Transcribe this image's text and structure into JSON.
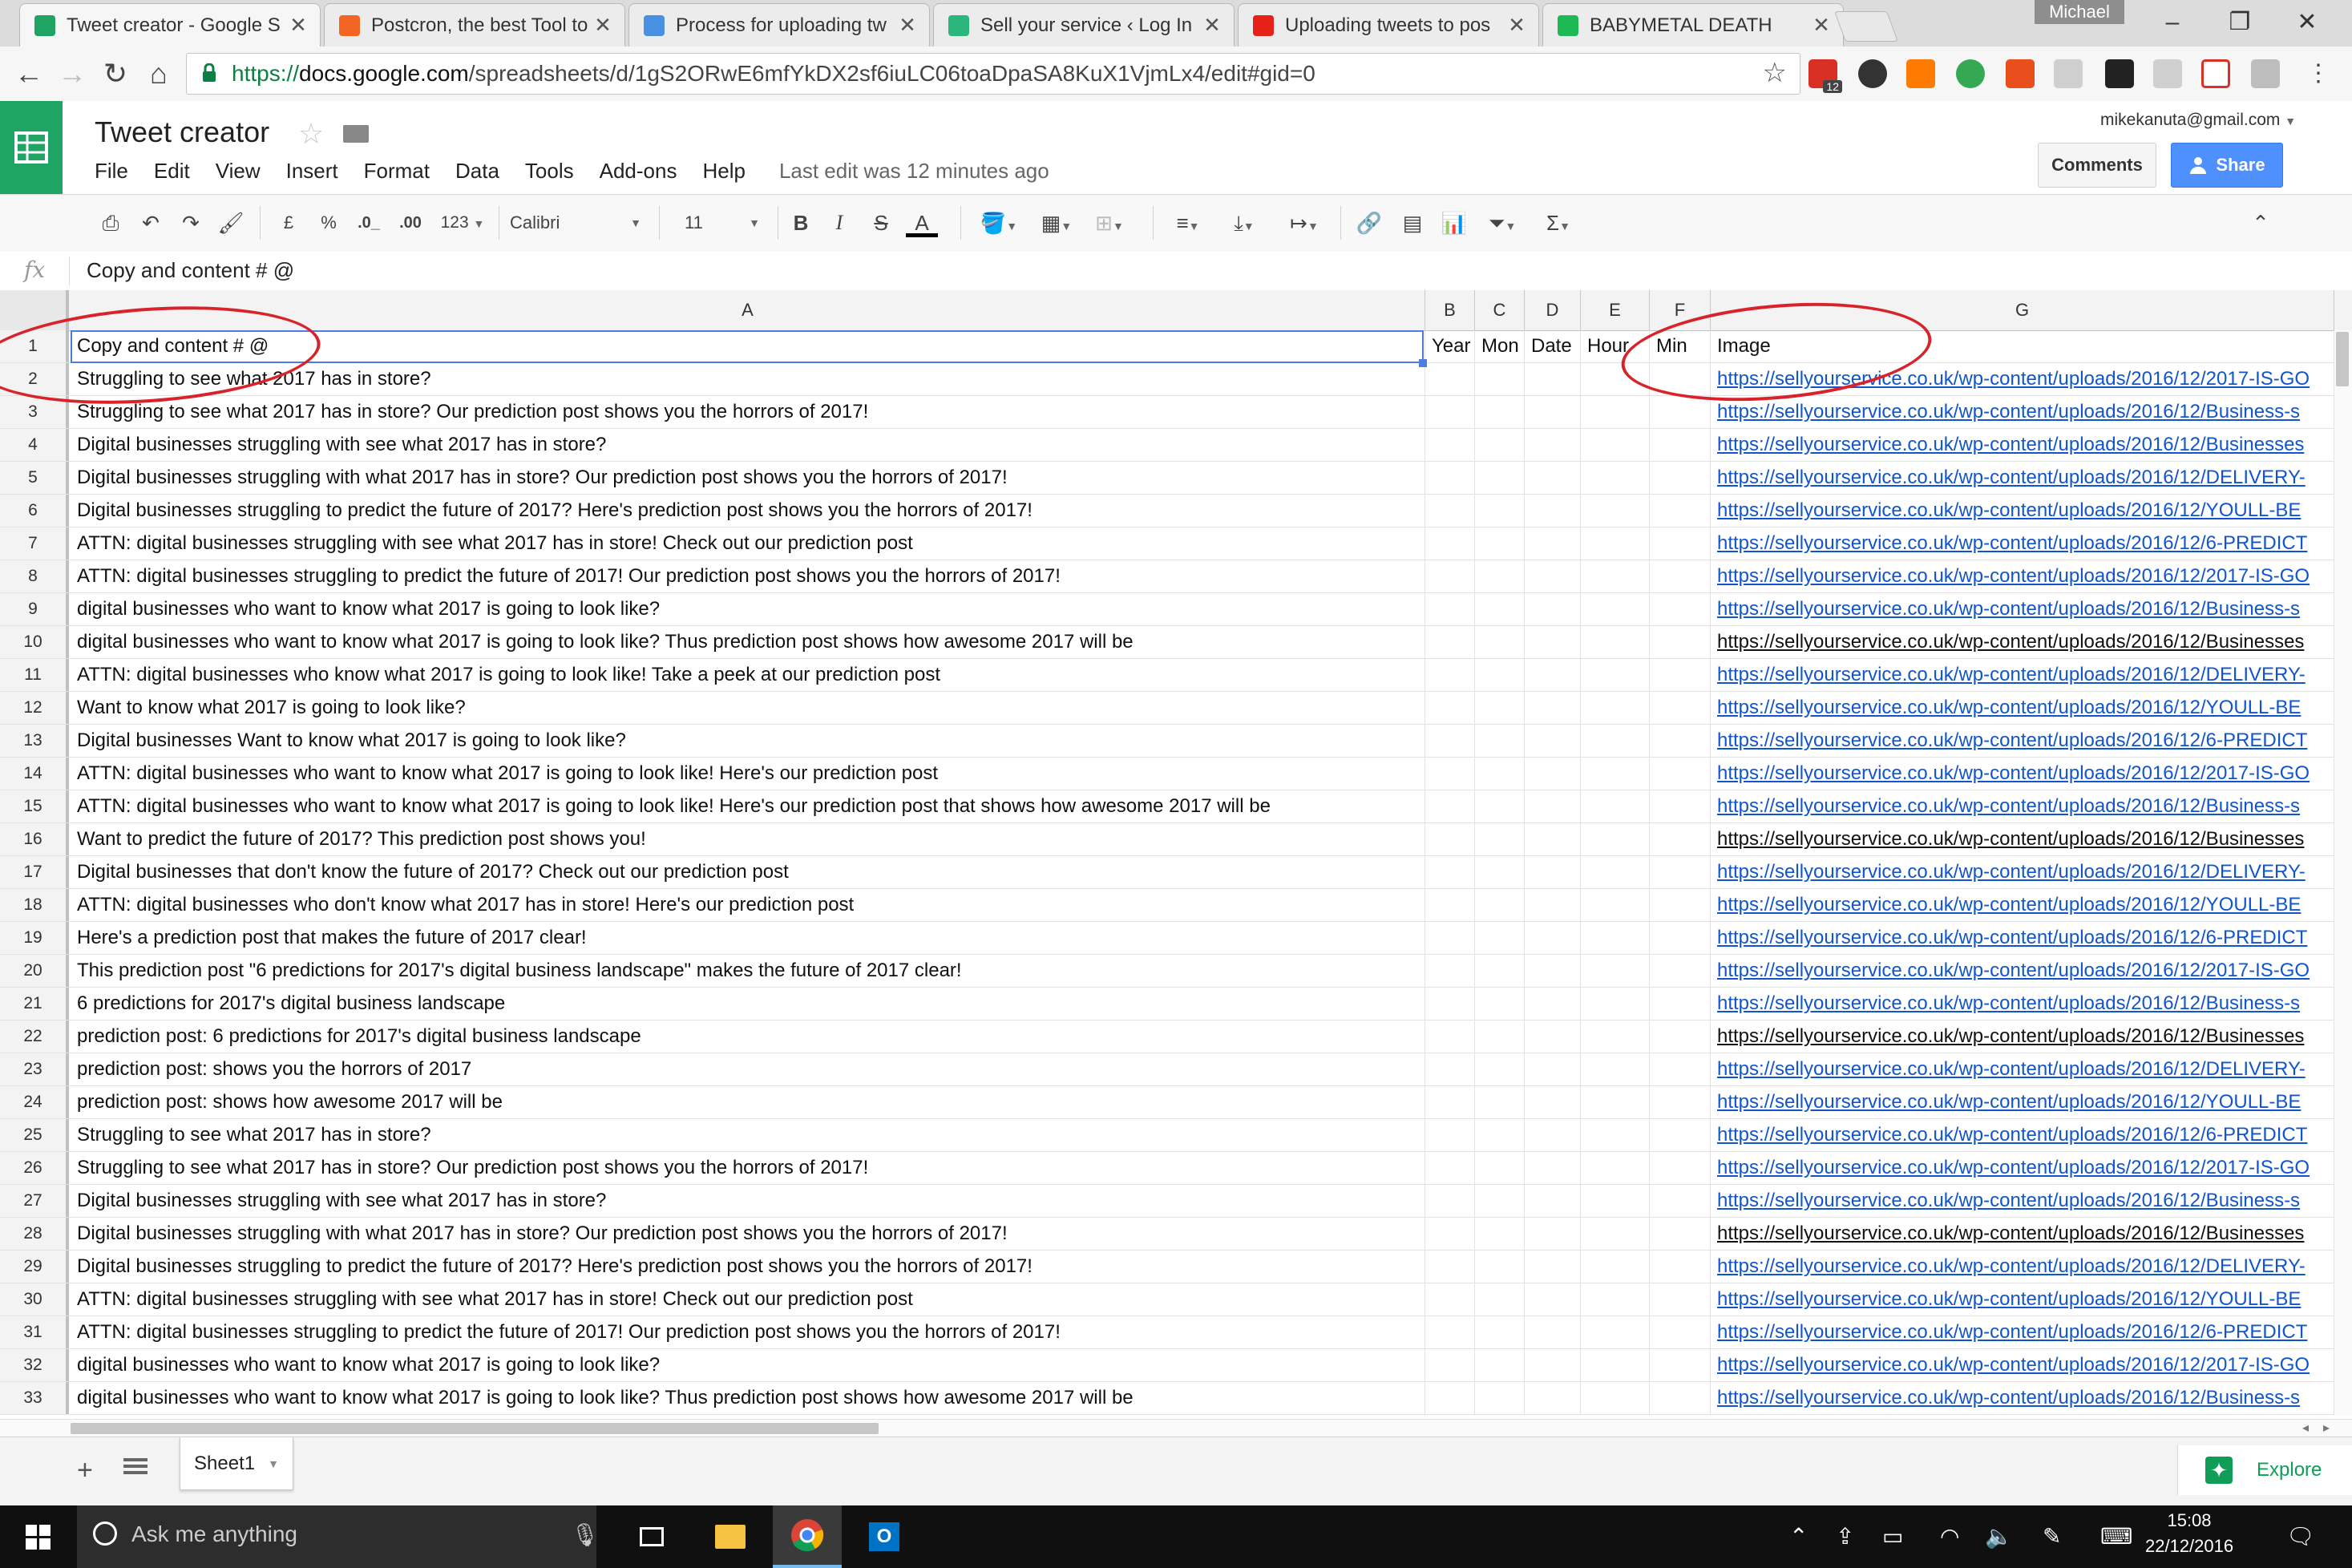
{
  "browser": {
    "tabs": [
      {
        "label": "Tweet creator - Google S",
        "icon": "google-sheets-icon",
        "color": "#1fa463",
        "active": true
      },
      {
        "label": "Postcron, the best Tool to",
        "icon": "postcron-icon",
        "color": "#f26522",
        "active": false
      },
      {
        "label": "Process for uploading tw",
        "icon": "process-icon",
        "color": "#4a90e2",
        "active": false
      },
      {
        "label": "Sell your service ‹ Log In",
        "icon": "page-icon",
        "color": "#2cb67d",
        "active": false
      },
      {
        "label": "Uploading tweets to pos",
        "icon": "youtube-icon",
        "color": "#e62117",
        "active": false
      },
      {
        "label": "BABYMETAL DEATH",
        "icon": "spotify-icon",
        "color": "#1db954",
        "active": false
      }
    ],
    "profile_name": "Michael",
    "url": {
      "scheme": "https://",
      "host": "docs.google.com",
      "path": "/spreadsheets/d/1gS2ORwE6mfYkDX2sf6iuLC06toaDpaSA8KuX1VjmLx4/edit#gid=0"
    },
    "extension_badge": "12"
  },
  "sheets": {
    "title": "Tweet creator",
    "menus": [
      "File",
      "Edit",
      "View",
      "Insert",
      "Format",
      "Data",
      "Tools",
      "Add-ons",
      "Help"
    ],
    "last_edit": "Last edit was 12 minutes ago",
    "account": "mikekanuta@gmail.com",
    "comments_label": "Comments",
    "share_label": "Share",
    "toolbar": {
      "currency": "£",
      "percent": "%",
      "dec_less": ".0_",
      "dec_more": ".00",
      "more_formats": "123",
      "font": "Calibri",
      "font_size": "11",
      "bold": "B",
      "italic": "I",
      "strike": "S",
      "text_color": "A"
    },
    "formula_icon": "fx",
    "formula_value": "Copy and content # @",
    "columns": [
      "A",
      "B",
      "C",
      "D",
      "E",
      "F",
      "G"
    ],
    "sheet_tab": "Sheet1",
    "explore_label": "Explore",
    "header_row": {
      "num": "1",
      "a": "Copy and content # @",
      "b": "Year",
      "c": "Mon",
      "d": "Date",
      "e": "Hour",
      "f": "Min",
      "g": "Image"
    },
    "rows": [
      {
        "num": "2",
        "a": "Struggling to see what 2017 has in store?",
        "g": "https://sellyourservice.co.uk/wp-content/uploads/2016/12/2017-IS-GO",
        "link": true
      },
      {
        "num": "3",
        "a": "Struggling to see what 2017 has in store? Our prediction post shows you the horrors of 2017!",
        "g": "https://sellyourservice.co.uk/wp-content/uploads/2016/12/Business-s",
        "link": true
      },
      {
        "num": "4",
        "a": "Digital businesses struggling with see what 2017 has in store?",
        "g": "https://sellyourservice.co.uk/wp-content/uploads/2016/12/Businesses",
        "link": true
      },
      {
        "num": "5",
        "a": "Digital businesses struggling with what 2017 has in store? Our prediction post shows you the horrors of 2017!",
        "g": "https://sellyourservice.co.uk/wp-content/uploads/2016/12/DELIVERY-",
        "link": true
      },
      {
        "num": "6",
        "a": "Digital businesses struggling to predict the future of 2017? Here's prediction post shows you the horrors of 2017!",
        "g": "https://sellyourservice.co.uk/wp-content/uploads/2016/12/YOULL-BE",
        "link": true
      },
      {
        "num": "7",
        "a": "ATTN: digital businesses struggling with see what 2017 has in store! Check out our prediction post",
        "g": "https://sellyourservice.co.uk/wp-content/uploads/2016/12/6-PREDICT",
        "link": true
      },
      {
        "num": "8",
        "a": "ATTN: digital businesses struggling to predict the future of 2017! Our prediction post shows you the horrors of 2017!",
        "g": "https://sellyourservice.co.uk/wp-content/uploads/2016/12/2017-IS-GO",
        "link": true
      },
      {
        "num": "9",
        "a": "digital businesses who want to know what 2017 is going to look like?",
        "g": "https://sellyourservice.co.uk/wp-content/uploads/2016/12/Business-s",
        "link": true
      },
      {
        "num": "10",
        "a": "digital businesses who want to know what 2017 is going to look like? Thus prediction post shows how awesome 2017 will be",
        "g": "https://sellyourservice.co.uk/wp-content/uploads/2016/12/Businesses",
        "link": false
      },
      {
        "num": "11",
        "a": "ATTN: digital businesses who know what 2017 is going to look like! Take a peek at our prediction post",
        "g": "https://sellyourservice.co.uk/wp-content/uploads/2016/12/DELIVERY-",
        "link": true
      },
      {
        "num": "12",
        "a": "Want to know what 2017 is going to look like?",
        "g": "https://sellyourservice.co.uk/wp-content/uploads/2016/12/YOULL-BE",
        "link": true
      },
      {
        "num": "13",
        "a": "Digital businesses Want to know what 2017 is going to look like?",
        "g": "https://sellyourservice.co.uk/wp-content/uploads/2016/12/6-PREDICT",
        "link": true
      },
      {
        "num": "14",
        "a": "ATTN: digital businesses who want to know what 2017 is going to look like! Here's our prediction post",
        "g": "https://sellyourservice.co.uk/wp-content/uploads/2016/12/2017-IS-GO",
        "link": true
      },
      {
        "num": "15",
        "a": "ATTN: digital businesses who want to know what 2017 is going to look like! Here's our prediction post that shows how awesome 2017 will be",
        "g": "https://sellyourservice.co.uk/wp-content/uploads/2016/12/Business-s",
        "link": true
      },
      {
        "num": "16",
        "a": "Want to predict the future of 2017? This prediction post shows you!",
        "g": "https://sellyourservice.co.uk/wp-content/uploads/2016/12/Businesses",
        "link": false
      },
      {
        "num": "17",
        "a": "Digital businesses that don't know the future of 2017? Check out our prediction post",
        "g": "https://sellyourservice.co.uk/wp-content/uploads/2016/12/DELIVERY-",
        "link": true
      },
      {
        "num": "18",
        "a": "ATTN: digital businesses who don't know what 2017 has in store! Here's our prediction post",
        "g": "https://sellyourservice.co.uk/wp-content/uploads/2016/12/YOULL-BE",
        "link": true
      },
      {
        "num": "19",
        "a": "Here's a prediction post that makes the future of 2017 clear!",
        "g": "https://sellyourservice.co.uk/wp-content/uploads/2016/12/6-PREDICT",
        "link": true
      },
      {
        "num": "20",
        "a": "This prediction post \"6 predictions for 2017's digital business landscape\" makes the future of 2017 clear!",
        "g": "https://sellyourservice.co.uk/wp-content/uploads/2016/12/2017-IS-GO",
        "link": true
      },
      {
        "num": "21",
        "a": "6 predictions for 2017's digital business landscape",
        "g": "https://sellyourservice.co.uk/wp-content/uploads/2016/12/Business-s",
        "link": true
      },
      {
        "num": "22",
        "a": "prediction post: 6 predictions for 2017's digital business landscape",
        "g": "https://sellyourservice.co.uk/wp-content/uploads/2016/12/Businesses",
        "link": false
      },
      {
        "num": "23",
        "a": "prediction post: shows you the horrors of 2017",
        "g": "https://sellyourservice.co.uk/wp-content/uploads/2016/12/DELIVERY-",
        "link": true
      },
      {
        "num": "24",
        "a": "prediction post: shows how awesome 2017 will be",
        "g": "https://sellyourservice.co.uk/wp-content/uploads/2016/12/YOULL-BE",
        "link": true
      },
      {
        "num": "25",
        "a": "Struggling to see what 2017 has in store?",
        "g": "https://sellyourservice.co.uk/wp-content/uploads/2016/12/6-PREDICT",
        "link": true
      },
      {
        "num": "26",
        "a": "Struggling to see what 2017 has in store? Our prediction post shows you the horrors of 2017!",
        "g": "https://sellyourservice.co.uk/wp-content/uploads/2016/12/2017-IS-GO",
        "link": true
      },
      {
        "num": "27",
        "a": "Digital businesses struggling with see what 2017 has in store?",
        "g": "https://sellyourservice.co.uk/wp-content/uploads/2016/12/Business-s",
        "link": true
      },
      {
        "num": "28",
        "a": "Digital businesses struggling with what 2017 has in store? Our prediction post shows you the horrors of 2017!",
        "g": "https://sellyourservice.co.uk/wp-content/uploads/2016/12/Businesses",
        "link": false
      },
      {
        "num": "29",
        "a": "Digital businesses struggling to predict the future of 2017? Here's prediction post shows you the horrors of 2017!",
        "g": "https://sellyourservice.co.uk/wp-content/uploads/2016/12/DELIVERY-",
        "link": true
      },
      {
        "num": "30",
        "a": "ATTN: digital businesses struggling with see what 2017 has in store! Check out our prediction post",
        "g": "https://sellyourservice.co.uk/wp-content/uploads/2016/12/YOULL-BE",
        "link": true
      },
      {
        "num": "31",
        "a": "ATTN: digital businesses struggling to predict the future of 2017! Our prediction post shows you the horrors of 2017!",
        "g": "https://sellyourservice.co.uk/wp-content/uploads/2016/12/6-PREDICT",
        "link": true
      },
      {
        "num": "32",
        "a": "digital businesses who want to know what 2017 is going to look like?",
        "g": "https://sellyourservice.co.uk/wp-content/uploads/2016/12/2017-IS-GO",
        "link": true
      },
      {
        "num": "33",
        "a": "digital businesses who want to know what 2017 is going to look like? Thus prediction post shows how awesome 2017 will be",
        "g": "https://sellyourservice.co.uk/wp-content/uploads/2016/12/Business-s",
        "link": true
      }
    ]
  },
  "taskbar": {
    "search_placeholder": "Ask me anything",
    "time": "15:08",
    "date": "22/12/2016"
  },
  "colors": {
    "sheets_green": "#1fa463",
    "share_blue": "#4d90fe",
    "link_blue": "#1155cc",
    "annotation_red": "#d8232a"
  }
}
